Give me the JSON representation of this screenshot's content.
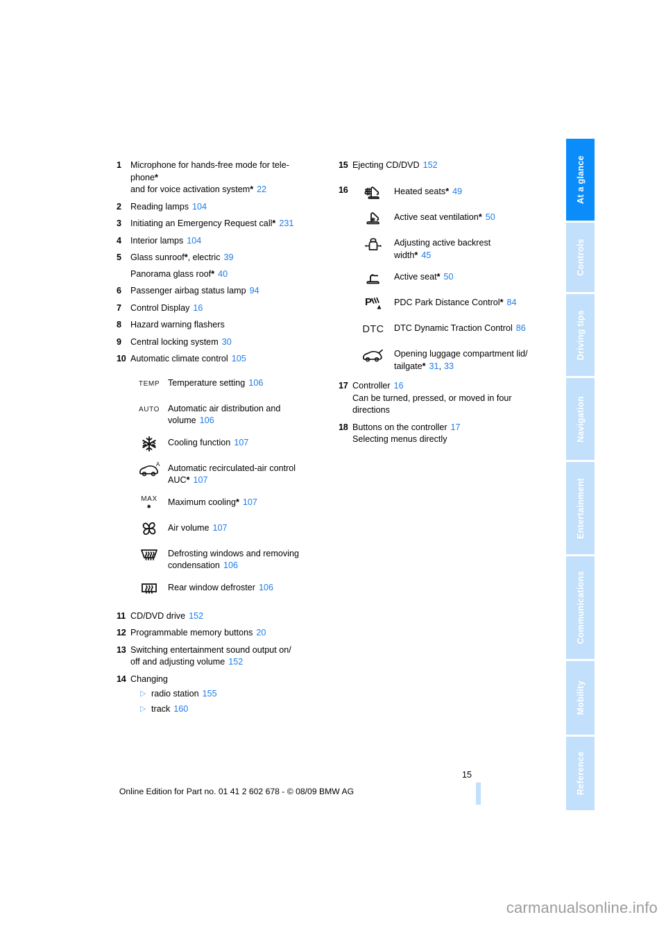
{
  "page": {
    "number": "15",
    "edition_line": "Online Edition for Part no. 01 41 2 602 678 - © 08/09 BMW AG",
    "watermark": "carmanualsonline.info",
    "ref_color": "#1c7ce8",
    "tab_active_color": "#0a8cfb",
    "tab_inactive_color": "#c2e0fb"
  },
  "tabs": [
    {
      "label": "At a glance",
      "active": true
    },
    {
      "label": "Controls",
      "active": false
    },
    {
      "label": "Driving tips",
      "active": false
    },
    {
      "label": "Navigation",
      "active": false
    },
    {
      "label": "Entertainment",
      "active": false
    },
    {
      "label": "Communications",
      "active": false
    },
    {
      "label": "Mobility",
      "active": false
    },
    {
      "label": "Reference",
      "active": false
    }
  ],
  "left_column": {
    "items": [
      {
        "num": "1",
        "line1": "Microphone for hands-free mode for tele-",
        "line2": "phone",
        "line2_star": "*",
        "line3": "and for voice activation system",
        "line3_star": "*",
        "line3_ref": "22"
      },
      {
        "num": "2",
        "line1": "Reading lamps",
        "ref": "104"
      },
      {
        "num": "3",
        "line1": "Initiating an Emergency Request call",
        "star": "*",
        "ref": "231"
      },
      {
        "num": "4",
        "line1": "Interior lamps",
        "ref": "104"
      },
      {
        "num": "5",
        "line1": "Glass sunroof",
        "star": "*",
        "line1_tail": ", electric",
        "ref": "39",
        "line2": "Panorama glass roof",
        "line2_star": "*",
        "line2_ref": "40"
      },
      {
        "num": "6",
        "line1": "Passenger airbag status lamp",
        "ref": "94"
      },
      {
        "num": "7",
        "line1": "Control Display",
        "ref": "16"
      },
      {
        "num": "8",
        "line1": "Hazard warning flashers",
        "ref": ""
      },
      {
        "num": "9",
        "line1": "Central locking system",
        "ref": "30"
      },
      {
        "num": "10",
        "line1": "Automatic climate control",
        "ref": "105"
      }
    ],
    "climate_icons": [
      {
        "icon": "temp-text-icon",
        "glyph": "TEMP",
        "line1": "Temperature setting",
        "ref": "106"
      },
      {
        "icon": "auto-text-icon",
        "glyph": "AUTO",
        "line1": "Automatic air distribution and",
        "line2": "volume",
        "ref": "106"
      },
      {
        "icon": "snowflake-icon",
        "glyph": "",
        "line1": "Cooling function",
        "ref": "107"
      },
      {
        "icon": "recirculated-air-car-icon",
        "glyph": "",
        "line1": "Automatic recirculated-air control",
        "line2": "AUC",
        "line2_star": "*",
        "ref": "107"
      },
      {
        "icon": "max-cooling-text-icon",
        "glyph": "MAX",
        "line1": "Maximum cooling",
        "star": "*",
        "ref": "107"
      },
      {
        "icon": "fan-icon",
        "glyph": "",
        "line1": "Air volume",
        "ref": "107"
      },
      {
        "icon": "windshield-defrost-icon",
        "glyph": "",
        "line1": "Defrosting windows and removing",
        "line2": "condensation",
        "ref": "106"
      },
      {
        "icon": "rear-window-defrost-icon",
        "glyph": "",
        "line1": "Rear window defroster",
        "ref": "106"
      }
    ],
    "items_after": [
      {
        "num": "11",
        "line1": "CD/DVD drive",
        "ref": "152"
      },
      {
        "num": "12",
        "line1": "Programmable memory buttons",
        "ref": "20"
      },
      {
        "num": "13",
        "line1": "Switching entertainment sound output on/",
        "line2": "off and adjusting volume",
        "line2_ref": "152"
      },
      {
        "num": "14",
        "line1": "Changing",
        "subs": [
          {
            "bullet": "▷",
            "text": "radio station",
            "ref": "155"
          },
          {
            "bullet": "▷",
            "text": "track",
            "ref": "160"
          }
        ]
      }
    ]
  },
  "right_column": {
    "item_15": {
      "num": "15",
      "line1": "Ejecting CD/DVD",
      "ref": "152"
    },
    "item_16_num": "16",
    "seat_icons": [
      {
        "icon": "heated-seat-icon",
        "line1": "Heated seats",
        "star": "*",
        "ref": "49"
      },
      {
        "icon": "seat-ventilation-icon",
        "line1": "Active seat ventilation",
        "star": "*",
        "ref": "50"
      },
      {
        "icon": "backrest-width-icon",
        "line1": "Adjusting active backrest",
        "line2": "width",
        "line2_star": "*",
        "ref": "45"
      },
      {
        "icon": "active-seat-icon",
        "line1": "Active seat",
        "star": "*",
        "ref": "50"
      },
      {
        "icon": "pdc-icon",
        "line1": "PDC Park Distance Control",
        "star": "*",
        "ref": "84"
      },
      {
        "icon": "dtc-text-icon",
        "glyph": "DTC",
        "line1": "DTC Dynamic Traction Control",
        "ref": "86"
      },
      {
        "icon": "trunk-lid-car-icon",
        "line1": "Opening luggage compartment lid/",
        "line2": "tailgate",
        "line2_star": "*",
        "ref": "31",
        "ref2": "33"
      }
    ],
    "items_after": [
      {
        "num": "17",
        "line1": "Controller",
        "ref": "16",
        "line2": "Can be turned, pressed, or moved in four",
        "line3": "directions"
      },
      {
        "num": "18",
        "line1": "Buttons on the controller",
        "ref": "17",
        "line2": "Selecting menus directly"
      }
    ]
  }
}
